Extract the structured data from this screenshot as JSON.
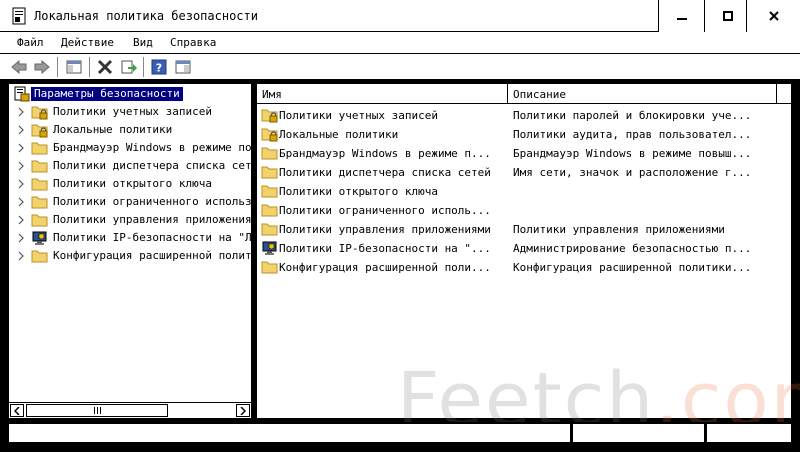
{
  "window": {
    "title": "Локальная политика безопасности"
  },
  "menu": [
    {
      "label": "Файл"
    },
    {
      "label": "Действие"
    },
    {
      "label": "Вид"
    },
    {
      "label": "Справка"
    }
  ],
  "toolbar_icons": [
    "back-arrow-icon",
    "forward-arrow-icon",
    "show-hide-tree-icon",
    "delete-icon",
    "export-list-icon",
    "help-icon",
    "properties-icon"
  ],
  "tree": {
    "root": "Параметры безопасности",
    "items": [
      {
        "label": "Политики учетных записей",
        "icon": "lock-folder-icon"
      },
      {
        "label": "Локальные политики",
        "icon": "lock-folder-icon"
      },
      {
        "label": "Брандмауэр Windows в режиме повышенной безопасности",
        "icon": "folder-icon"
      },
      {
        "label": "Политики диспетчера списка сетей",
        "icon": "folder-icon"
      },
      {
        "label": "Политики открытого ключа",
        "icon": "folder-icon"
      },
      {
        "label": "Политики ограниченного использования программ",
        "icon": "folder-icon"
      },
      {
        "label": "Политики управления приложениями",
        "icon": "folder-icon"
      },
      {
        "label": "Политики IP-безопасности на \"Локальный компьютер\"",
        "icon": "ipsec-monitor-icon"
      },
      {
        "label": "Конфигурация расширенной политики аудита",
        "icon": "folder-icon"
      }
    ]
  },
  "list": {
    "columns": {
      "name": "Имя",
      "description": "Описание"
    },
    "rows": [
      {
        "name": "Политики учетных записей",
        "description": "Политики паролей и блокировки уче...",
        "icon": "lock-folder-icon"
      },
      {
        "name": "Локальные политики",
        "description": "Политики аудита, прав пользовател...",
        "icon": "lock-folder-icon"
      },
      {
        "name": "Брандмауэр Windows в режиме п...",
        "description": "Брандмауэр Windows в режиме повыш...",
        "icon": "folder-icon"
      },
      {
        "name": "Политики диспетчера списка сетей",
        "description": "Имя сети, значок и расположение г...",
        "icon": "folder-icon"
      },
      {
        "name": "Политики открытого ключа",
        "description": "",
        "icon": "folder-icon"
      },
      {
        "name": "Политики ограниченного исполь...",
        "description": "",
        "icon": "folder-icon"
      },
      {
        "name": "Политики управления приложениями",
        "description": "Политики управления приложениями",
        "icon": "folder-icon"
      },
      {
        "name": "Политики IP-безопасности на \"...",
        "description": "Администрирование безопасностью п...",
        "icon": "ipsec-monitor-icon"
      },
      {
        "name": "Конфигурация расширенной поли...",
        "description": "Конфигурация расширенной политики...",
        "icon": "folder-icon"
      }
    ]
  },
  "watermark": {
    "part1": "Feetch",
    "part2": ".com"
  },
  "colors": {
    "selection": "#000080",
    "folder": "#f4d26b",
    "lock": "#d9a400"
  }
}
